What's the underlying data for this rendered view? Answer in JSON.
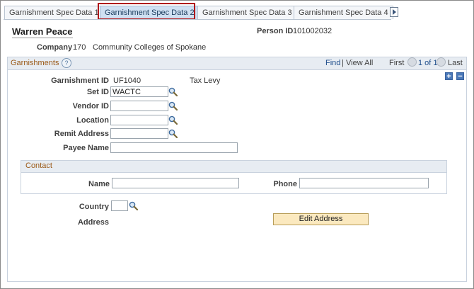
{
  "tabs": [
    {
      "label": "Garnishment Spec Data 1"
    },
    {
      "label": "Garnishment Spec Data 2"
    },
    {
      "label": "Garnishment Spec Data 3"
    },
    {
      "label": "Garnishment Spec Data 4"
    }
  ],
  "header": {
    "person_name": "Warren Peace",
    "person_id_label": "Person ID",
    "person_id_value": "101002032",
    "company_label": "Company",
    "company_code": "170",
    "company_name": "Community Colleges of Spokane"
  },
  "garnishments": {
    "title": "Garnishments",
    "find": "Find",
    "separator": "|",
    "view_all": "View All",
    "first": "First",
    "page_info": "1 of 1",
    "last": "Last",
    "garnishment_id_label": "Garnishment ID",
    "garnishment_id_value": "UF1040",
    "garnishment_type": "Tax Levy",
    "set_id_label": "Set ID",
    "set_id_value": "WACTC",
    "vendor_id_label": "Vendor ID",
    "vendor_id_value": "",
    "location_label": "Location",
    "location_value": "",
    "remit_address_label": "Remit Address",
    "remit_address_value": "",
    "payee_name_label": "Payee Name",
    "payee_name_value": ""
  },
  "contact": {
    "title": "Contact",
    "name_label": "Name",
    "name_value": "",
    "phone_label": "Phone",
    "phone_value": ""
  },
  "address": {
    "country_label": "Country",
    "country_value": "",
    "address_label": "Address",
    "edit_address_button": "Edit Address"
  },
  "icons": {
    "lookup": "magnifier-icon",
    "help": "help-icon",
    "next_tab": "next-tab-arrow-icon",
    "add_row": "plus-icon",
    "delete_row": "minus-icon"
  },
  "colors": {
    "section_title": "#9b5a18",
    "active_tab": "#cfe0f2",
    "highlight_border": "#b0181b",
    "button_bg": "#fbe9bf"
  }
}
